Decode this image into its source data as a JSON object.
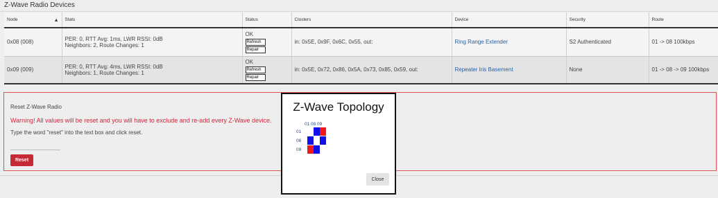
{
  "section_title": "Z-Wave Radio Devices",
  "table": {
    "headers": {
      "node": "Node",
      "stats": "Stats",
      "status": "Status",
      "clusters": "Clusters",
      "device": "Device",
      "security": "Security",
      "route": "Route"
    },
    "sort_indicator": "▲",
    "rows": [
      {
        "node": "0x08 (008)",
        "stats_line1": "PER: 0, RTT Avg: 1ms, LWR RSSI: 0dB",
        "stats_line2": "Neighbors: 2, Route Changes: 1",
        "status": "OK",
        "refresh_label": "Refresh",
        "repair_label": "Repair",
        "clusters": "in: 0x5E, 0x9F, 0x6C, 0x55, out:",
        "device": "Ring Range Extender",
        "security": "S2 Authenticated",
        "route": "01 -> 08 100kbps"
      },
      {
        "node": "0x09 (009)",
        "stats_line1": "PER: 0, RTT Avg: 4ms, LWR RSSI: 0dB",
        "stats_line2": "Neighbors: 1, Route Changes: 1",
        "status": "OK",
        "refresh_label": "Refresh",
        "repair_label": "Repair",
        "clusters": "in: 0x5E, 0x72, 0x86, 0x5A, 0x73, 0x85, 0x59, out:",
        "device": "Repeater Iris Basement",
        "security": "None",
        "route": "01 -> 08 -> 09 100kbps"
      }
    ]
  },
  "reset": {
    "title": "Reset Z-Wave Radio",
    "warning": "Warning! All values will be reset and you will have to exclude and re-add every Z-Wave device.",
    "instruction": "Type the word \"reset\" into the text box and click reset.",
    "input_value": "",
    "button_label": "Reset"
  },
  "topology_modal": {
    "title": "Z-Wave Topology",
    "nodes": [
      "01",
      "08",
      "09"
    ],
    "matrix": [
      [
        "none",
        "blue",
        "red"
      ],
      [
        "blue",
        "none",
        "blue"
      ],
      [
        "red",
        "blue",
        "none"
      ]
    ],
    "colors": {
      "blue": "#1010e8",
      "red": "#f01818"
    },
    "close_label": "Close"
  },
  "colors": {
    "link": "#2c5f9e",
    "warning": "#d0263a",
    "reset_button": "#c62a36",
    "reset_border": "#d9534f"
  }
}
